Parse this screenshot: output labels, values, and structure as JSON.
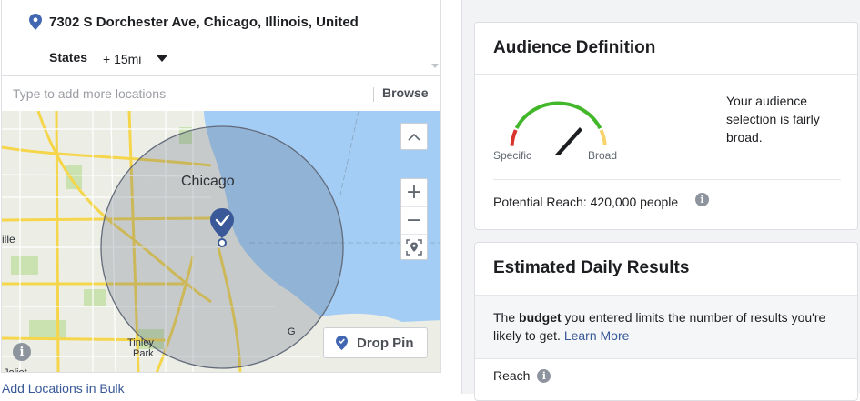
{
  "location": {
    "address": "7302 S Dorchester Ave, Chicago, Illinois, United",
    "address_line2": "States",
    "radius": "+ 15mi"
  },
  "search": {
    "placeholder": "Type to add more locations",
    "browse_label": "Browse"
  },
  "map": {
    "labels": [
      "Chicago",
      "ille",
      "Tinley",
      "Park",
      "Joliet",
      "G"
    ],
    "drop_pin_label": "Drop Pin",
    "zoom_in": "+",
    "zoom_out": "−"
  },
  "add_bulk_label": "Add Locations in Bulk",
  "audience": {
    "title": "Audience Definition",
    "gauge_specific": "Specific",
    "gauge_broad": "Broad",
    "description": "Your audience selection is fairly broad.",
    "potential_reach": "Potential Reach: 420,000 people"
  },
  "results": {
    "title": "Estimated Daily Results",
    "note_pre": "The ",
    "note_bold": "budget",
    "note_post": " you entered limits the number of results you're likely to get. ",
    "learn_more": "Learn More",
    "reach_label": "Reach"
  },
  "colors": {
    "pin": "#4267b2",
    "link": "#385898",
    "water": "#a3cdf5",
    "gauge_red": "#d9342c",
    "gauge_green": "#42b72a",
    "gauge_yellow": "#f7d36b"
  }
}
